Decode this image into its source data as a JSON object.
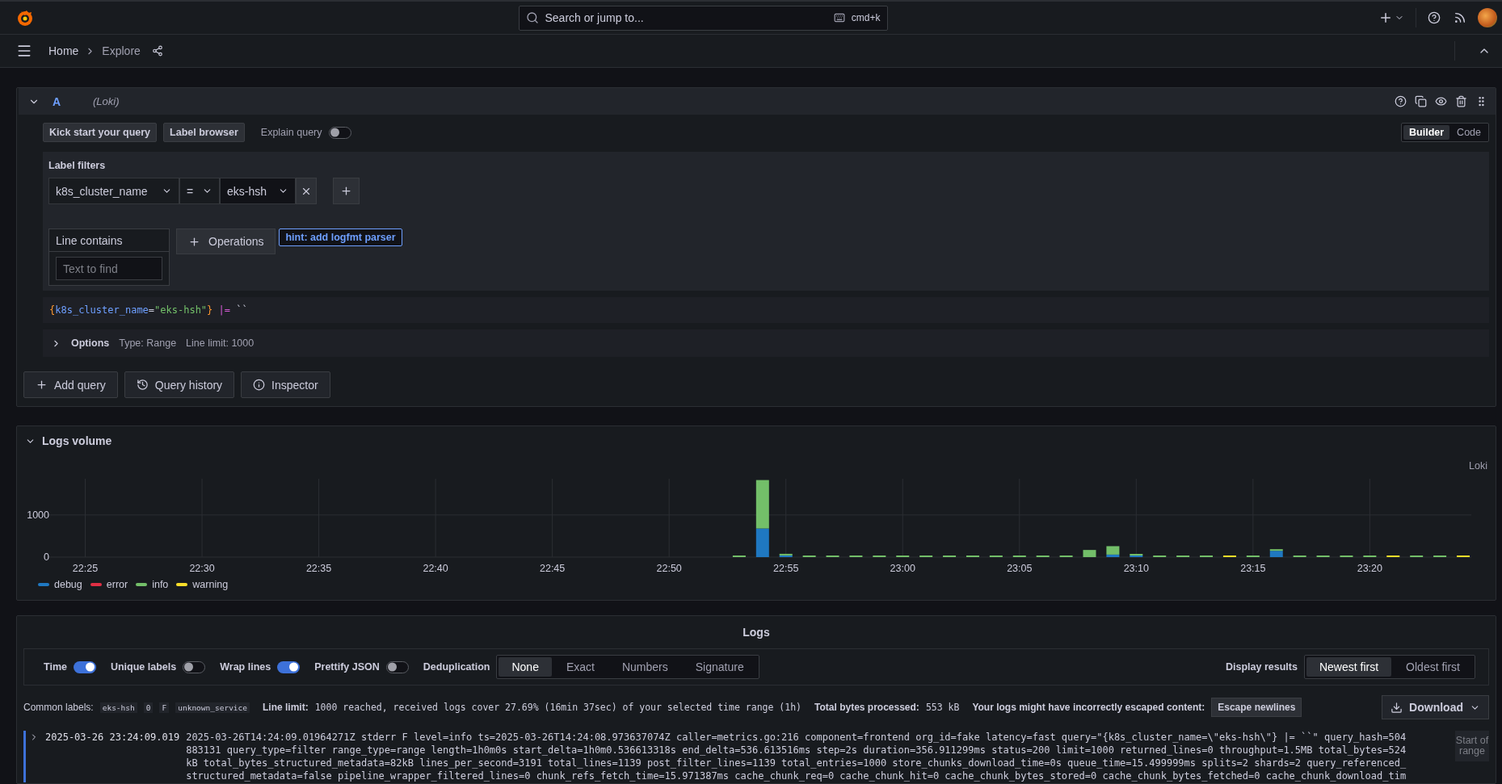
{
  "topbar": {
    "search_placeholder": "Search or jump to...",
    "shortcut": "cmd+k"
  },
  "breadcrumbs": [
    {
      "label": "Home",
      "current": false
    },
    {
      "label": "Explore",
      "current": true
    }
  ],
  "query": {
    "letter": "A",
    "datasource": "(Loki)",
    "expanded": true,
    "buttons": [
      "Kick start your query",
      "Label browser"
    ],
    "explain": {
      "label": "Explain query",
      "on": false
    },
    "modes": [
      {
        "label": "Builder",
        "selected": true
      },
      {
        "label": "Code",
        "selected": false
      }
    ],
    "label_filters": {
      "title": "Label filters",
      "filters": [
        {
          "label": "k8s_cluster_name",
          "operator": "=",
          "value": "eks-hsh"
        }
      ]
    },
    "line_contains": {
      "title": "Line contains",
      "placeholder": "Text to find"
    },
    "operations": "Operations",
    "hint": "hint: add logfmt parser",
    "preview": [
      {
        "kind": "brace",
        "text": "{"
      },
      {
        "kind": "label",
        "text": "k8s_cluster_name"
      },
      {
        "kind": "plain",
        "text": "="
      },
      {
        "kind": "string",
        "text": "\"eks-hsh\""
      },
      {
        "kind": "brace",
        "text": "}"
      },
      {
        "kind": "pipe",
        "text": " |="
      },
      {
        "kind": "plain",
        "text": " ``"
      }
    ],
    "options": {
      "label": "Options",
      "expanded": false,
      "items": [
        "Type: Range",
        "Line limit: 1000"
      ]
    }
  },
  "query_actions": [
    {
      "kind": "add",
      "label": "Add query"
    },
    {
      "kind": "history",
      "label": "Query history"
    },
    {
      "kind": "inspector",
      "label": "Inspector"
    }
  ],
  "logs_volume": {
    "title": "Logs volume",
    "expanded": true,
    "source": "Loki",
    "chart_data": {
      "type": "bar",
      "stacked": true,
      "grid": true,
      "categories": [
        null,
        "22:25",
        null,
        null,
        null,
        null,
        "22:30",
        null,
        null,
        null,
        null,
        "22:35",
        null,
        null,
        null,
        null,
        "22:40",
        null,
        null,
        null,
        null,
        "22:45",
        null,
        null,
        null,
        null,
        "22:50",
        null,
        null,
        null,
        null,
        "22:55",
        null,
        null,
        null,
        null,
        "23:00",
        null,
        null,
        null,
        null,
        "23:05",
        null,
        null,
        null,
        null,
        "23:10",
        null,
        null,
        null,
        null,
        "23:15",
        null,
        null,
        null,
        null,
        "23:20",
        null,
        null,
        null,
        null
      ],
      "series": [
        {
          "name": "debug",
          "color": "#1f78c1",
          "values": [
            0,
            0,
            0,
            0,
            0,
            0,
            0,
            0,
            0,
            0,
            0,
            0,
            0,
            0,
            0,
            0,
            0,
            0,
            0,
            0,
            0,
            0,
            0,
            0,
            0,
            0,
            0,
            0,
            0,
            0,
            680,
            40,
            0,
            0,
            0,
            0,
            0,
            0,
            0,
            0,
            0,
            0,
            0,
            0,
            0,
            60,
            30,
            0,
            0,
            0,
            0,
            0,
            150,
            0,
            0,
            0,
            0,
            0,
            0,
            0,
            0
          ]
        },
        {
          "name": "error",
          "color": "#e02f44",
          "values": [
            0,
            0,
            0,
            0,
            0,
            0,
            0,
            0,
            0,
            0,
            0,
            0,
            0,
            0,
            0,
            0,
            0,
            0,
            0,
            0,
            0,
            0,
            0,
            0,
            0,
            0,
            0,
            0,
            0,
            0,
            0,
            0,
            0,
            0,
            0,
            0,
            0,
            0,
            0,
            0,
            0,
            0,
            0,
            0,
            0,
            0,
            0,
            0,
            0,
            0,
            0,
            0,
            0,
            0,
            0,
            0,
            0,
            0,
            0,
            0,
            0
          ]
        },
        {
          "name": "info",
          "color": "#73bf69",
          "values": [
            0,
            0,
            0,
            0,
            0,
            0,
            0,
            0,
            0,
            0,
            0,
            0,
            0,
            0,
            0,
            0,
            0,
            0,
            0,
            0,
            0,
            0,
            0,
            0,
            0,
            0,
            0,
            0,
            0,
            10,
            1150,
            20,
            10,
            10,
            10,
            10,
            10,
            10,
            10,
            10,
            10,
            10,
            10,
            10,
            170,
            200,
            30,
            10,
            10,
            10,
            0,
            10,
            30,
            10,
            10,
            10,
            10,
            0,
            10,
            10,
            0
          ]
        },
        {
          "name": "warning",
          "color": "#fade2a",
          "values": [
            0,
            0,
            0,
            0,
            0,
            0,
            0,
            0,
            0,
            0,
            0,
            0,
            0,
            0,
            0,
            0,
            0,
            0,
            0,
            0,
            0,
            0,
            0,
            0,
            0,
            0,
            0,
            0,
            0,
            0,
            0,
            0,
            0,
            0,
            0,
            0,
            0,
            0,
            0,
            0,
            0,
            0,
            0,
            0,
            0,
            0,
            0,
            0,
            0,
            0,
            20,
            0,
            0,
            0,
            0,
            0,
            0,
            20,
            0,
            0,
            20
          ]
        }
      ],
      "ylim": [
        0,
        1860
      ],
      "yticks": [
        0,
        1000
      ]
    }
  },
  "logs": {
    "title": "Logs",
    "toggles": [
      {
        "label": "Time",
        "on": true
      },
      {
        "label": "Unique labels",
        "on": false
      },
      {
        "label": "Wrap lines",
        "on": true
      },
      {
        "label": "Prettify JSON",
        "on": false
      }
    ],
    "dedup": {
      "label": "Deduplication",
      "options": [
        {
          "label": "None",
          "selected": true
        },
        {
          "label": "Exact",
          "selected": false
        },
        {
          "label": "Numbers",
          "selected": false
        },
        {
          "label": "Signature",
          "selected": false
        }
      ]
    },
    "display": {
      "label": "Display results",
      "options": [
        {
          "label": "Newest first",
          "selected": true
        },
        {
          "label": "Oldest first",
          "selected": false
        }
      ]
    },
    "common_labels": {
      "label": "Common labels:",
      "values": [
        "eks-hsh",
        "0",
        "F",
        "unknown_service"
      ]
    },
    "line_limit": {
      "label": "Line limit:",
      "value": "1000 reached, received logs cover 27.69% (16min 37sec) of your selected time range (1h)"
    },
    "bytes": {
      "label": "Total bytes processed:",
      "value": "553 kB"
    },
    "escape": {
      "text": "Your logs might have incorrectly escaped content:",
      "button": "Escape newlines"
    },
    "download": "Download",
    "rows": [
      {
        "time": "2025-03-26 23:24:09.019",
        "expanded": false,
        "action": "Start of range",
        "message": "2025-03-26T14:24:09.01964271Z stderr F level=info ts=2025-03-26T14:24:08.973637074Z caller=metrics.go:216 component=frontend org_id=fake latency=fast query=\"{k8s_cluster_name=\\\"eks-hsh\\\"} |= ``\" query_hash=504883131 query_type=filter range_type=range length=1h0m0s start_delta=1h0m0.536613318s end_delta=536.613516ms step=2s duration=356.911299ms status=200 limit=1000 returned_lines=0 throughput=1.5MB total_bytes=524kB total_bytes_structured_metadata=82kB lines_per_second=3191 total_lines=1139 post_filter_lines=1139 total_entries=1000 store_chunks_download_time=0s queue_time=15.499999ms splits=2 shards=2 query_referenced_structured_metadata=false pipeline_wrapper_filtered_lines=0 chunk_refs_fetch_time=15.971387ms cache_chunk_req=0 cache_chunk_hit=0 cache_chunk_bytes_stored=0 cache_chunk_bytes_fetched=0 cache_chunk_download_tim"
      }
    ]
  }
}
